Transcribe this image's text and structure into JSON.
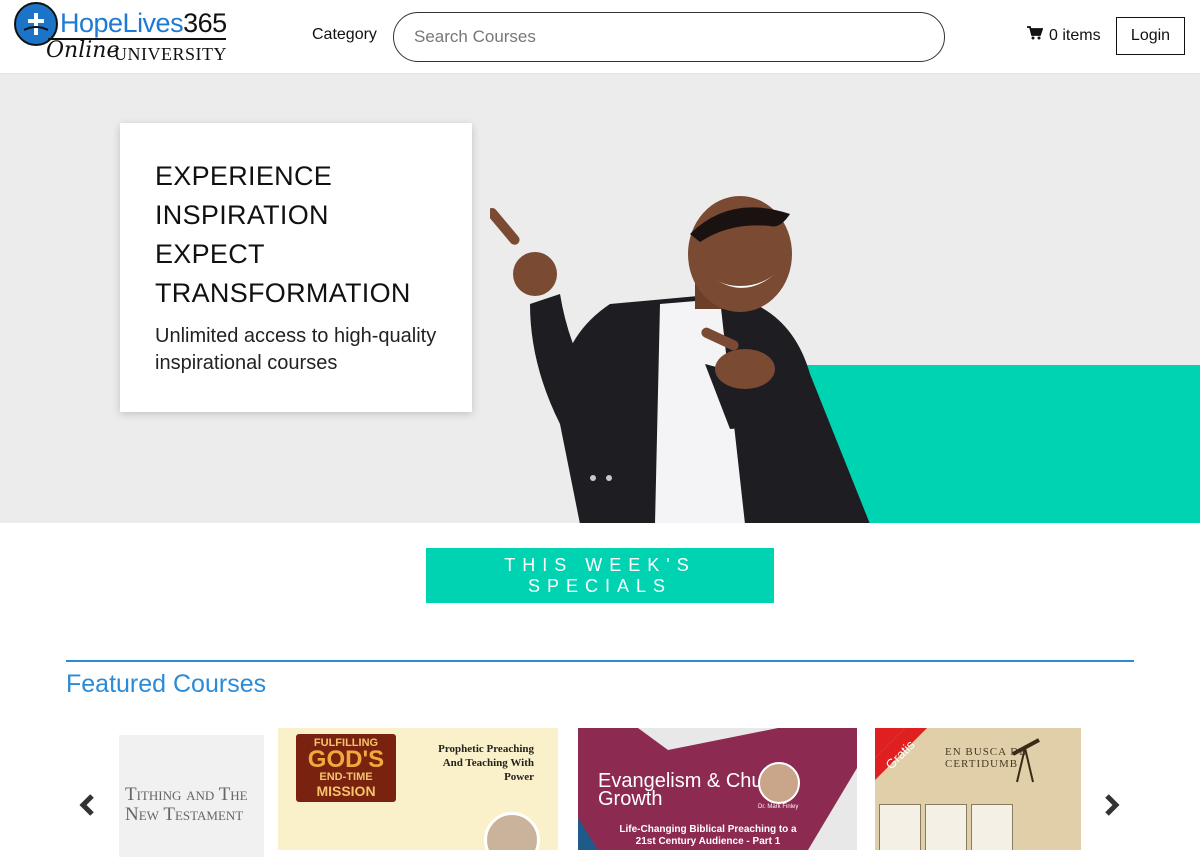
{
  "header": {
    "logo": {
      "brand": "HopeLives",
      "brand_num": "365",
      "online": "Online",
      "university": "UNIVERSITY"
    },
    "category_label": "Category",
    "search_placeholder": "Search Courses",
    "cart_label": "0 items",
    "login_label": "Login"
  },
  "hero": {
    "title_lines": [
      "EXPERIENCE",
      "INSPIRATION",
      "EXPECT",
      "TRANSFORMATION"
    ],
    "subtitle": "Unlimited access to high-quality inspirational courses",
    "accent_color": "#00d3b1"
  },
  "specials_label": "THIS WEEK'S SPECIALS",
  "featured": {
    "title": "Featured Courses",
    "accent_color": "#2a8bd9",
    "prev_icon": "chevron-left-icon",
    "next_icon": "chevron-right-icon",
    "cards": [
      {
        "text": "Tithing and The New Testament"
      },
      {
        "mission_l1": "FULFILLING",
        "mission_l2": "GOD'S",
        "mission_l3": "END-TIME",
        "mission_l4": "MISSION",
        "side_text": "Prophetic Preaching And Teaching With Power"
      },
      {
        "title": "Evangelism & Church Growth",
        "subtitle": "Life-Changing Biblical Preaching to a 21st Century Audience - Part 1",
        "presenter": "Dr. Mark Finley"
      },
      {
        "badge": "Gratis",
        "book_title": "EN BUSCA DE CERTIDUMB"
      }
    ]
  }
}
